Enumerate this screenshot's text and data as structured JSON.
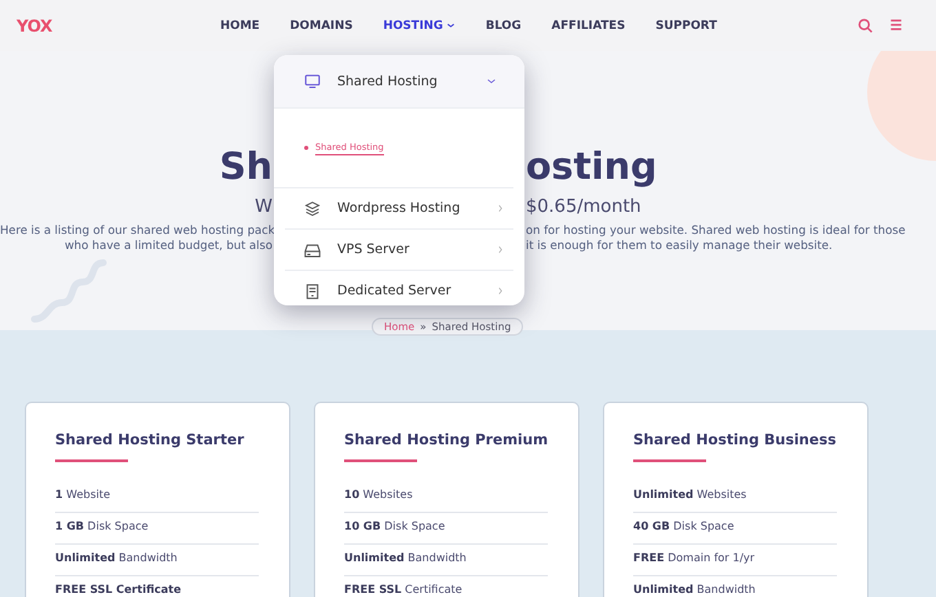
{
  "header": {
    "logo": "YOX",
    "nav": [
      {
        "label": "HOME",
        "selected": false,
        "has_caret": false
      },
      {
        "label": "DOMAINS",
        "selected": false,
        "has_caret": false
      },
      {
        "label": "HOSTING",
        "selected": true,
        "has_caret": true
      },
      {
        "label": "BLOG",
        "selected": false,
        "has_caret": false
      },
      {
        "label": "AFFILIATES",
        "selected": false,
        "has_caret": false
      },
      {
        "label": "SUPPORT",
        "selected": false,
        "has_caret": false
      }
    ]
  },
  "hero": {
    "title_left": "Sh",
    "title_right": "osting",
    "subtitle_left": "W",
    "subtitle_right": "$0.65/month",
    "lines": [
      {
        "left": "Here is a listing of our shared web hosting pack",
        "right": "on for hosting your website. Shared web hosting is ideal for those"
      },
      {
        "left": "who have a limited budget, but also",
        "right": "it is enough for them to easily manage their website."
      }
    ]
  },
  "hosting_menu": {
    "items": [
      {
        "label": "Shared Hosting",
        "kind": "monitor",
        "expanded": true,
        "children": [
          {
            "label": "Shared Hosting"
          }
        ]
      },
      {
        "label": "Wordpress Hosting",
        "kind": "layers",
        "expanded": false
      },
      {
        "label": "VPS Server",
        "kind": "drive",
        "expanded": false
      },
      {
        "label": "Dedicated Server",
        "kind": "server",
        "expanded": false
      }
    ]
  },
  "breadcrumb": {
    "home": "Home",
    "separator": "»",
    "current": "Shared Hosting"
  },
  "plans": [
    {
      "title": "Shared Hosting Starter",
      "features": [
        {
          "strong": "1",
          "text": "Website"
        },
        {
          "strong": "1 GB",
          "text": "Disk Space"
        },
        {
          "strong": "Unlimited",
          "text": "Bandwidth"
        },
        {
          "strong": "FREE SSL Certificate"
        }
      ]
    },
    {
      "title": "Shared Hosting Premium",
      "features": [
        {
          "strong": "10",
          "text": "Websites"
        },
        {
          "strong": "10 GB",
          "text": "Disk Space"
        },
        {
          "strong": "Unlimited",
          "text": "Bandwidth"
        },
        {
          "strong": "FREE SSL",
          "text": "Certificate"
        }
      ]
    },
    {
      "title": "Shared Hosting Business",
      "features": [
        {
          "strong": "Unlimited",
          "text": "Websites"
        },
        {
          "strong": "40 GB",
          "text": "Disk Space"
        },
        {
          "strong": "FREE",
          "text": "Domain for 1/yr"
        },
        {
          "strong": "Unlimited",
          "text": "Bandwidth"
        }
      ]
    }
  ]
}
